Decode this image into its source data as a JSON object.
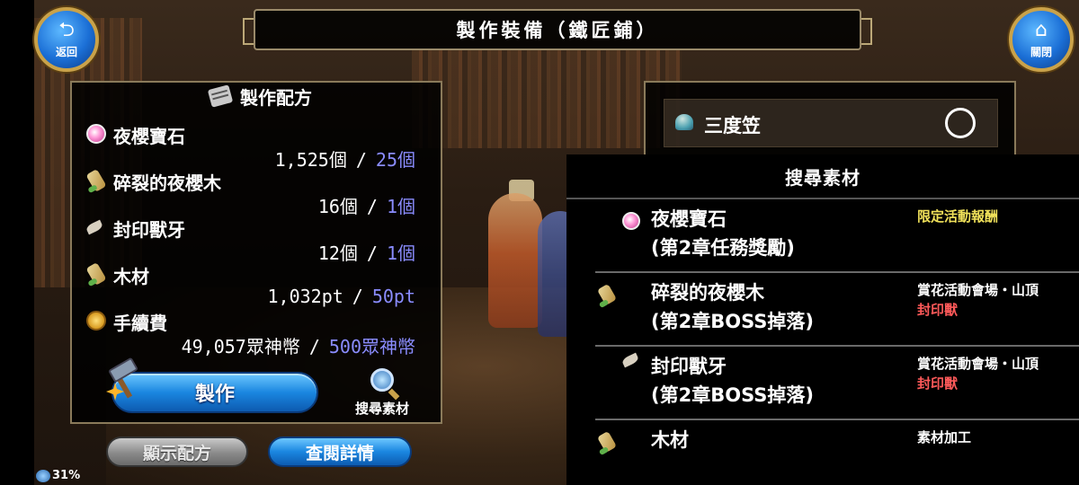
{
  "header": {
    "title": "製作裝備（鐵匠鋪）",
    "back_label": "返回",
    "close_label": "關閉"
  },
  "recipe": {
    "title": "製作配方",
    "materials": [
      {
        "name": "夜櫻寶石",
        "icon": "gem-icon",
        "have": "1,525個",
        "need": "25個"
      },
      {
        "name": "碎裂的夜櫻木",
        "icon": "wood-icon",
        "have": "16個",
        "need": "1個"
      },
      {
        "name": "封印獸牙",
        "icon": "fang-icon",
        "have": "12個",
        "need": "1個"
      },
      {
        "name": "木材",
        "icon": "wood-icon",
        "have": "1,032pt",
        "need": "50pt"
      },
      {
        "name": "手續費",
        "icon": "coin-icon",
        "have": "49,057眾神幣",
        "need": "500眾神幣"
      }
    ],
    "separator": "/",
    "make_label": "製作",
    "search_label": "搜尋素材"
  },
  "bottom": {
    "show_recipe_label": "顯示配方",
    "detail_label": "查閱詳情",
    "battery": "31%"
  },
  "equipment": {
    "name": "三度笠",
    "status_symbol": "○"
  },
  "sources": {
    "title": "搜尋素材",
    "rows": [
      {
        "name_line1": "夜櫻寶石",
        "name_line2": "(第2章任務獎勵)",
        "icon": "gem-icon",
        "src_line1": "限定活動報酬",
        "src_line2": ""
      },
      {
        "name_line1": "碎裂的夜櫻木",
        "name_line2": "(第2章BOSS掉落)",
        "icon": "wood-icon",
        "src_line1": "賞花活動會場・山頂",
        "src_line2": "封印獸"
      },
      {
        "name_line1": "封印獸牙",
        "name_line2": "(第2章BOSS掉落)",
        "icon": "fang-icon",
        "src_line1": "賞花活動會場・山頂",
        "src_line2": "封印獸"
      },
      {
        "name_line1": "木材",
        "name_line2": "",
        "icon": "wood-icon",
        "src_line1": "素材加工",
        "src_line2": ""
      }
    ]
  },
  "colors": {
    "need_value": "#8a8cff",
    "source_yellow": "#f0e15a",
    "source_red": "#ff5a5a",
    "button_blue": "#1a86e0"
  }
}
